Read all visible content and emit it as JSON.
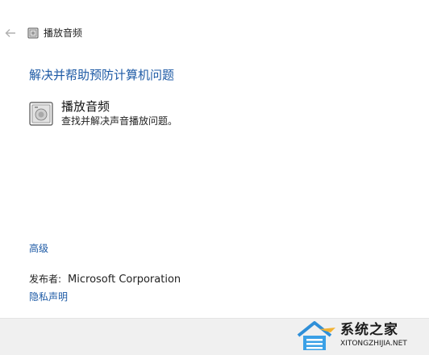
{
  "header": {
    "back_icon": "back-arrow-icon",
    "window_icon": "speaker-icon",
    "title": "播放音频"
  },
  "main": {
    "heading": "解决并帮助预防计算机问题",
    "troubleshooter": {
      "icon": "speaker-icon",
      "title": "播放音频",
      "description": "查找并解决声音播放问题。"
    },
    "advanced_link": "高级",
    "publisher_label": "发布者:",
    "publisher_value": "Microsoft Corporation",
    "privacy_link": "隐私声明"
  },
  "watermark": {
    "text": "系统之家",
    "subtext": "XITONGZHIJIA.NET"
  },
  "colors": {
    "link": "#1d5aa5",
    "footer_bg": "#f0f0f0"
  }
}
